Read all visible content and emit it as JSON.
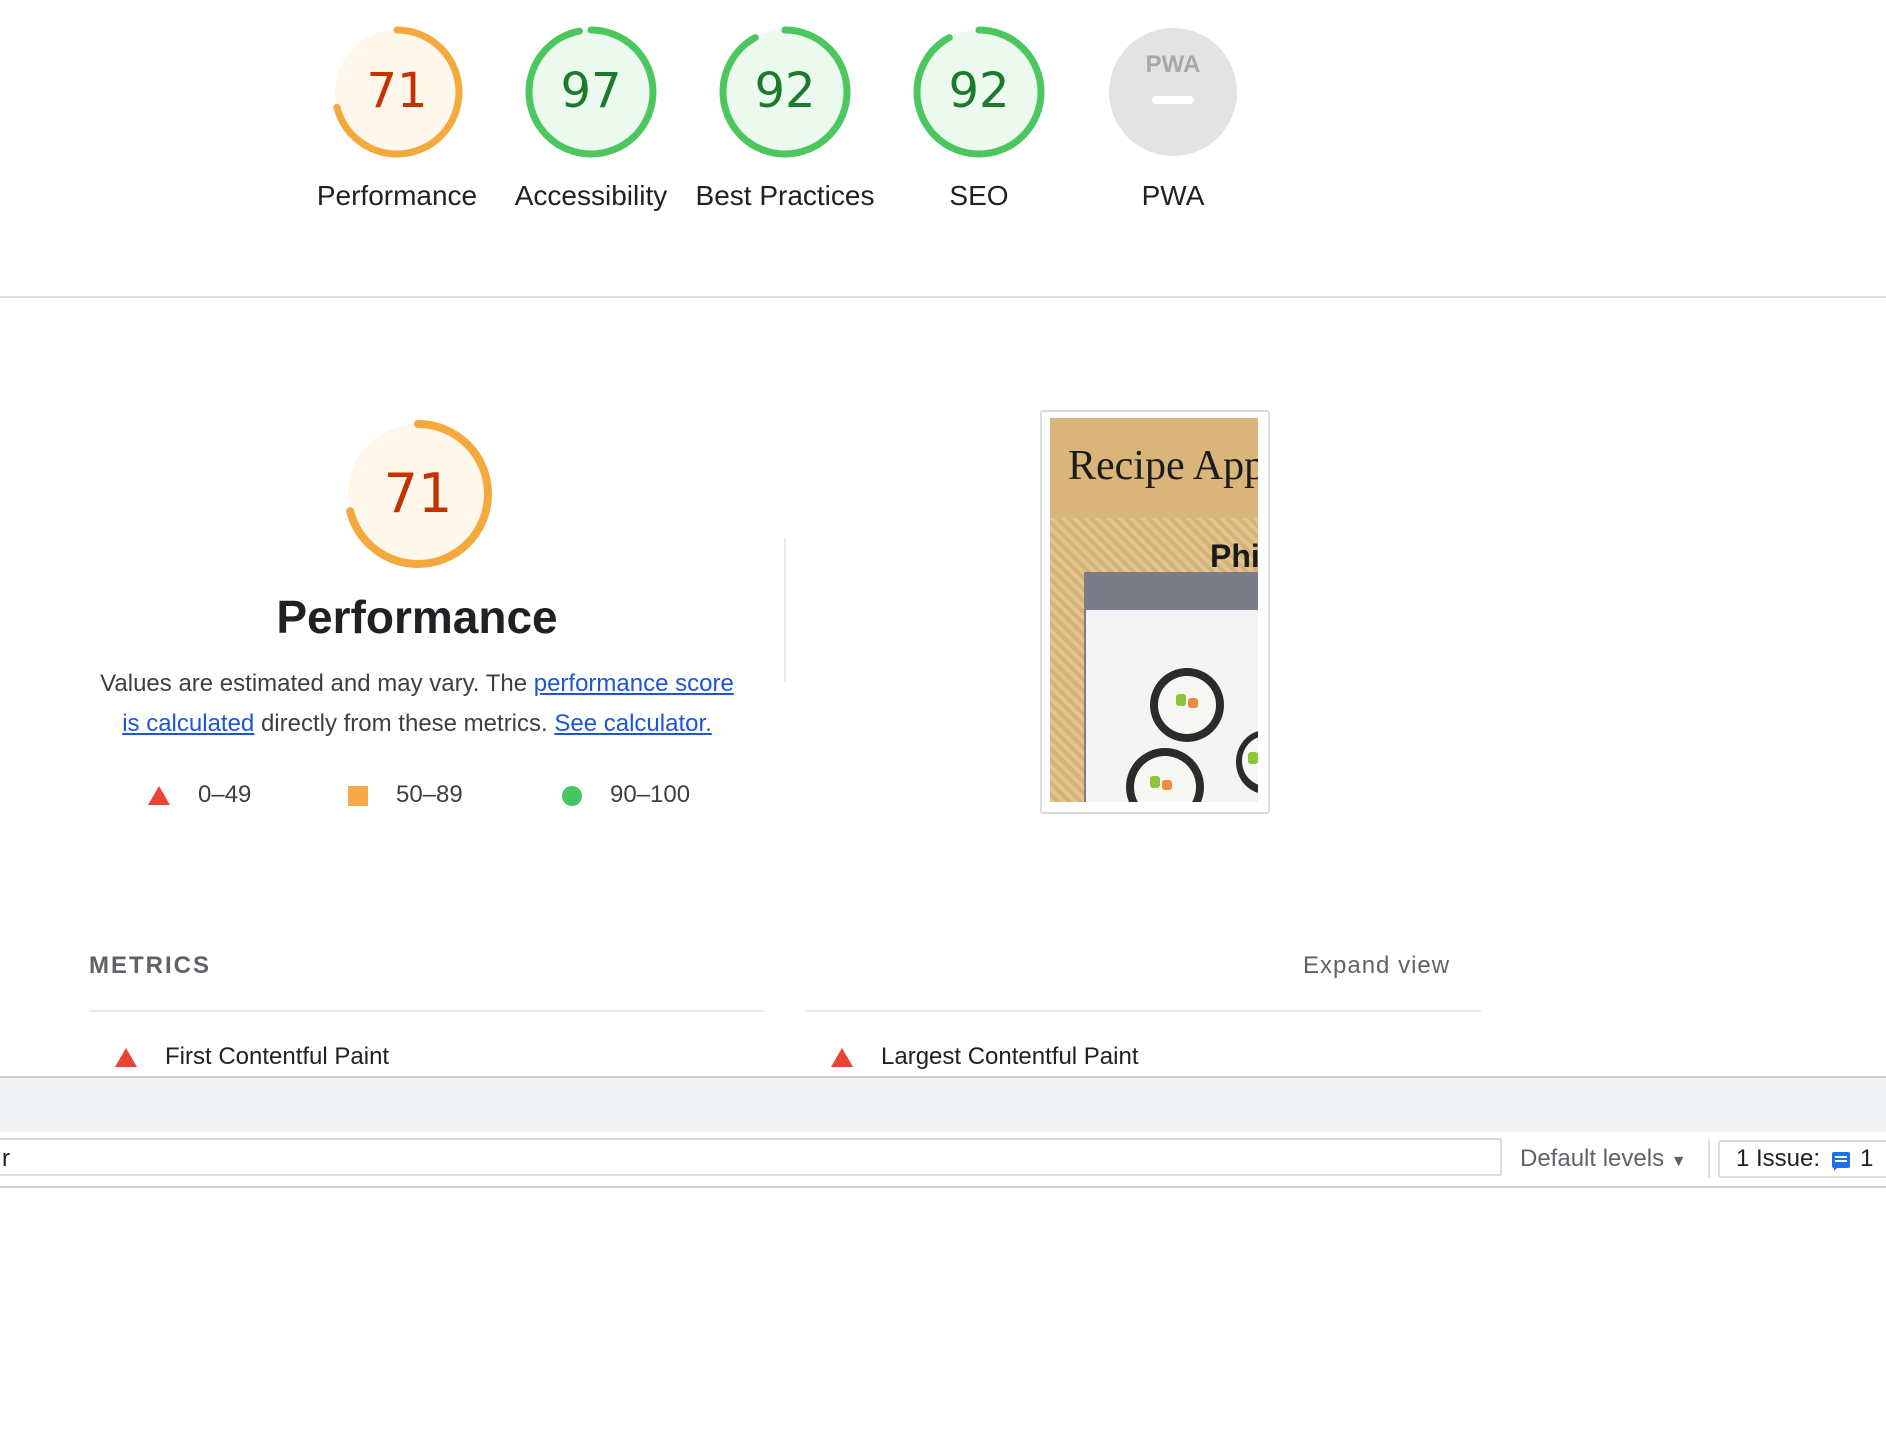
{
  "summary": {
    "gauges": [
      {
        "id": "performance",
        "score": "71",
        "label": "Performance",
        "score_fraction": 0.71,
        "level": "average",
        "ring_color": "#f4a93c",
        "fill_color": "#fff6ec",
        "text_color": "#c33300"
      },
      {
        "id": "accessibility",
        "score": "97",
        "label": "Accessibility",
        "score_fraction": 0.97,
        "level": "pass",
        "ring_color": "#4cc760",
        "fill_color": "#ecf9ef",
        "text_color": "#1b7a2c"
      },
      {
        "id": "best-practices",
        "score": "92",
        "label": "Best Practices",
        "score_fraction": 0.92,
        "level": "pass",
        "ring_color": "#4cc760",
        "fill_color": "#ecf9ef",
        "text_color": "#1b7a2c"
      },
      {
        "id": "seo",
        "score": "92",
        "label": "SEO",
        "score_fraction": 0.92,
        "level": "pass",
        "ring_color": "#4cc760",
        "fill_color": "#ecf9ef",
        "text_color": "#1b7a2c"
      }
    ],
    "pwa": {
      "badge_text": "PWA",
      "label": "PWA",
      "fill_color": "#e3e3e3",
      "mark_color": "#a8a8a8"
    }
  },
  "performance": {
    "score": "71",
    "score_fraction": 0.71,
    "title": "Performance",
    "desc_prefix": "Values are estimated and may vary. The ",
    "link_score": "performance score is calculated",
    "desc_middle": " directly from these metrics. ",
    "link_calculator": "See calculator.",
    "legend": [
      {
        "shape": "triangle",
        "range": "0–49",
        "color": "#eb4335"
      },
      {
        "shape": "square",
        "range": "50–89",
        "color": "#f6a84b"
      },
      {
        "shape": "circle",
        "range": "90–100",
        "color": "#45c463"
      }
    ]
  },
  "thumbnail": {
    "header_text": "Recipe App",
    "sub_text": "Phi"
  },
  "metrics": {
    "title": "METRICS",
    "expand_label": "Expand view",
    "items": [
      {
        "label": "First Contentful Paint",
        "status": "fail"
      },
      {
        "label": "Largest Contentful Paint",
        "status": "fail"
      }
    ]
  },
  "devtools": {
    "filter_value": "r",
    "levels_label": "Default levels",
    "issues_label": "1 Issue:",
    "issues_count": "1"
  }
}
